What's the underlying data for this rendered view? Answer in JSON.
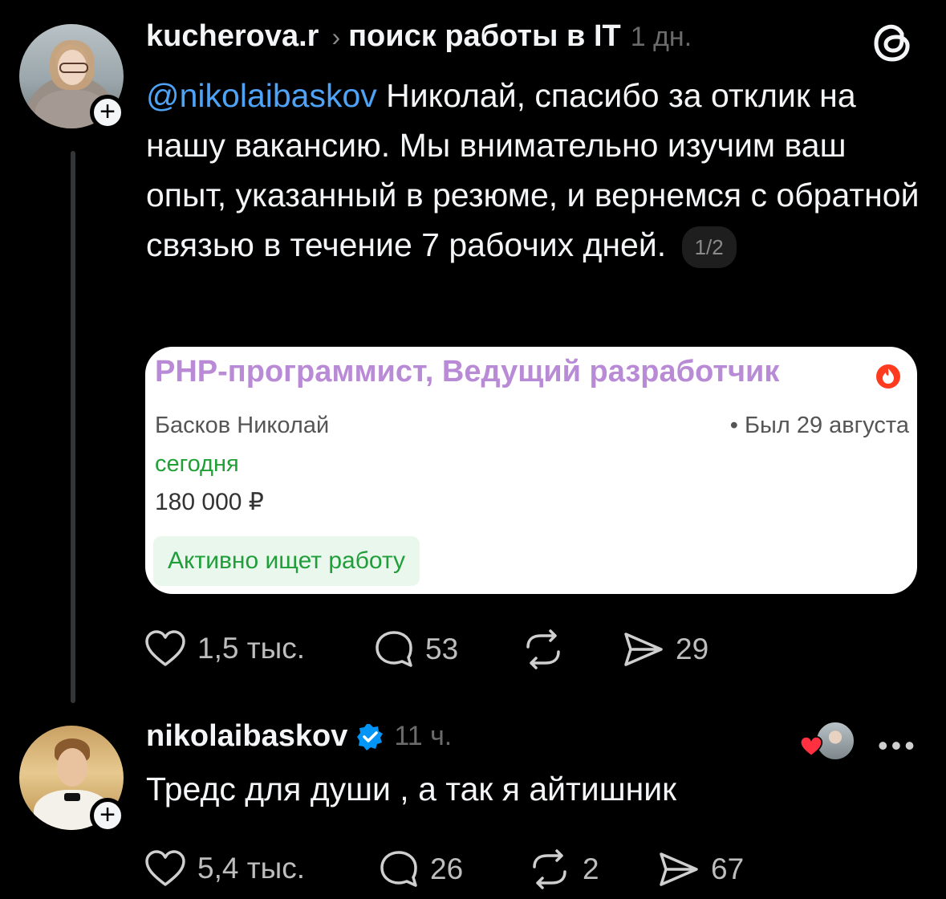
{
  "post1": {
    "username": "kucherova.r",
    "chevron": "›",
    "topic": "поиск работы в IT",
    "time": "1 дн.",
    "mention": "@nikolaibaskov",
    "text": " Николай, спасибо за отклик на нашу вакансию. Мы внимательно изучим ваш опыт, указанный в резюме, и вернемся с обратной связью в течение 7 рабочих дней.",
    "pager": "1/2",
    "card": {
      "title": "PHP-программист, Ведущий разработчик",
      "name": "Басков Николай",
      "seen": "• Был 29 августа",
      "today": "сегодня",
      "salary": "180 000 ₽",
      "badge": "Активно ищет работу"
    },
    "likes": "1,5 тыс.",
    "comments": "53",
    "reposts": "",
    "shares": "29"
  },
  "post2": {
    "username": "nikolaibaskov",
    "time": "11 ч.",
    "text": "Тредс для души , а так я айтишник",
    "likes": "5,4 тыс.",
    "comments": "26",
    "reposts": "2",
    "shares": "67",
    "more": "•••"
  },
  "icons": {
    "follow": "+",
    "app_logo": "threads-logo",
    "colors": {
      "mention": "#4fa3f7",
      "verified": "#0095f6",
      "heart": "#ff3040",
      "card_title": "#b98ad6",
      "green": "#21a038"
    }
  }
}
